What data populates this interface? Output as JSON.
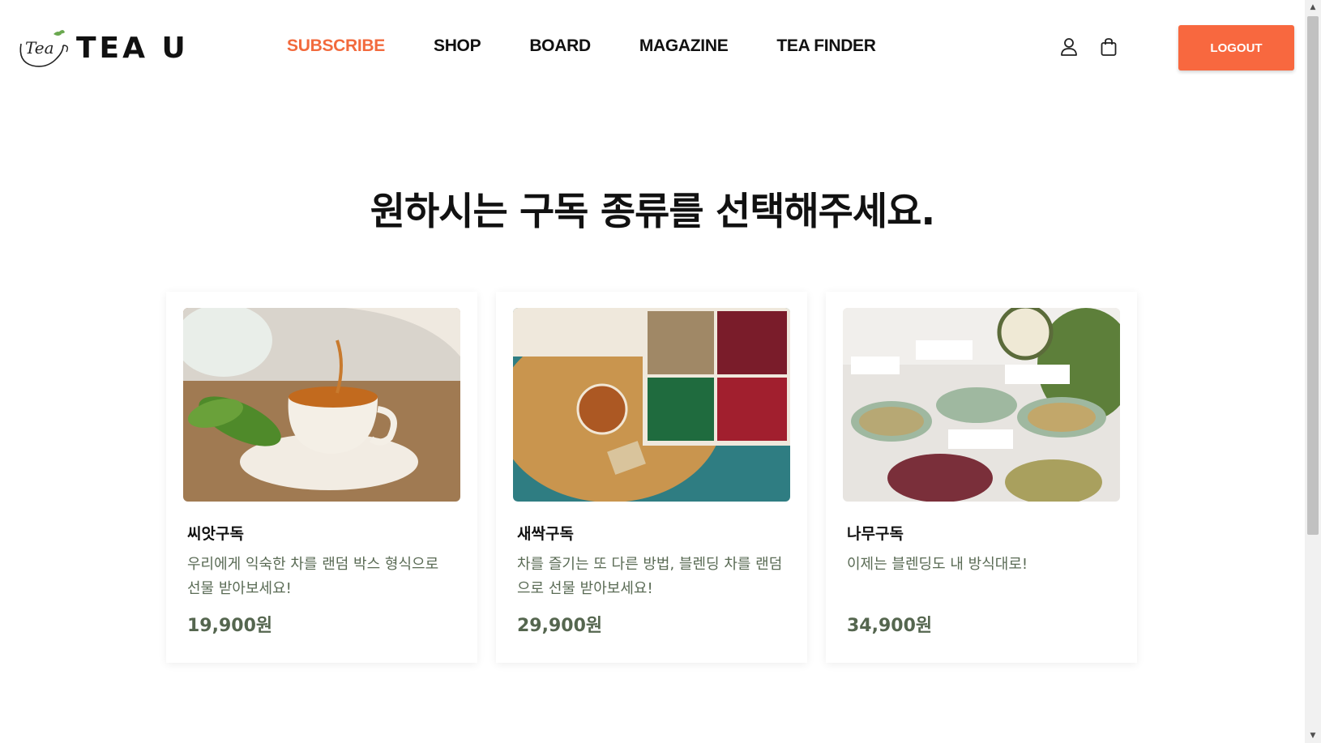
{
  "brand": {
    "logo_script": "Tea",
    "logo_text": "TEA U"
  },
  "nav": {
    "items": [
      {
        "label": "SUBSCRIBE",
        "active": true
      },
      {
        "label": "SHOP",
        "active": false
      },
      {
        "label": "BOARD",
        "active": false
      },
      {
        "label": "MAGAZINE",
        "active": false
      },
      {
        "label": "TEA FINDER",
        "active": false
      }
    ]
  },
  "header": {
    "user_icon": "user-icon",
    "cart_icon": "shopping-bag-icon",
    "logout_label": "LOGOUT"
  },
  "main": {
    "title": "원하시는 구독 종류를 선택해주세요.",
    "cards": [
      {
        "name": "씨앗구독",
        "description": "우리에게 익숙한 차를 랜덤 박스 형식으로 선물 받아보세요!",
        "price": "19,900원",
        "image": "teacup-pouring-photo"
      },
      {
        "name": "새싹구독",
        "description": "차를 즐기는 또 다른 방법, 블렌딩 차를 랜덤으로 선물 받아보세요!",
        "price": "29,900원",
        "image": "tea-box-photo"
      },
      {
        "name": "나무구독",
        "description": "이제는 블렌딩도 내 방식대로!",
        "price": "34,900원",
        "image": "tea-jars-photo"
      }
    ]
  },
  "colors": {
    "accent": "#f26a3d",
    "button": "#f8683f",
    "description": "#5a6b55",
    "price": "#55664f"
  }
}
